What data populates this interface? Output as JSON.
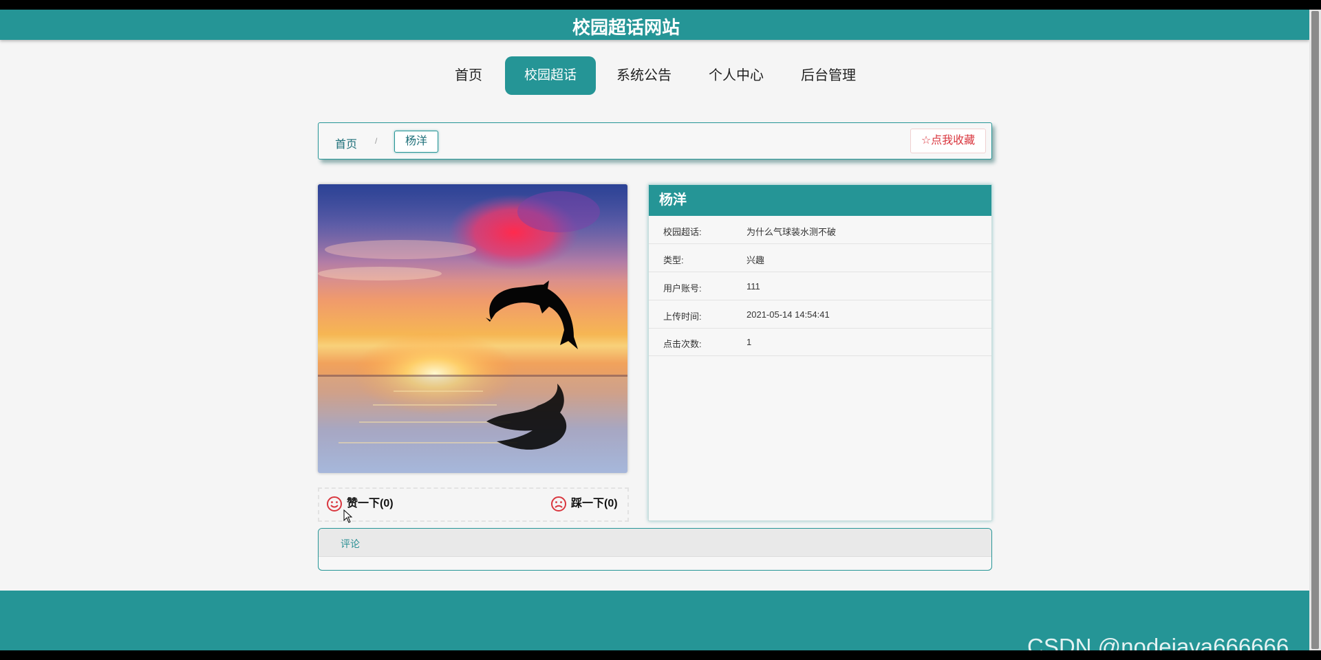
{
  "site": {
    "title": "校园超话网站"
  },
  "nav": {
    "items": [
      {
        "label": "首页",
        "active": false
      },
      {
        "label": "校园超话",
        "active": true
      },
      {
        "label": "系统公告",
        "active": false
      },
      {
        "label": "个人中心",
        "active": false
      },
      {
        "label": "后台管理",
        "active": false
      }
    ]
  },
  "breadcrumb": {
    "home": "首页",
    "separator": "/",
    "current": "杨洋"
  },
  "favorite": {
    "label": "点我收藏",
    "icon": "star-outline-icon"
  },
  "votes": {
    "like": {
      "label": "赞一下(0)",
      "icon": "smile-face-icon"
    },
    "dislike": {
      "label": "踩一下(0)",
      "icon": "sad-face-icon"
    }
  },
  "detail": {
    "title": "杨洋",
    "rows": [
      {
        "key": "校园超话:",
        "value": "为什么气球装水测不破"
      },
      {
        "key": "类型:",
        "value": "兴趣"
      },
      {
        "key": "用户账号:",
        "value": "111"
      },
      {
        "key": "上传时间:",
        "value": "2021-05-14 14:54:41"
      },
      {
        "key": "点击次数:",
        "value": "1"
      }
    ]
  },
  "comment": {
    "tab_label": "评论"
  },
  "watermark": "CSDN @nodejava666666",
  "colors": {
    "primary": "#259596",
    "favorite": "#d9363e",
    "background": "#f5f5f5"
  }
}
